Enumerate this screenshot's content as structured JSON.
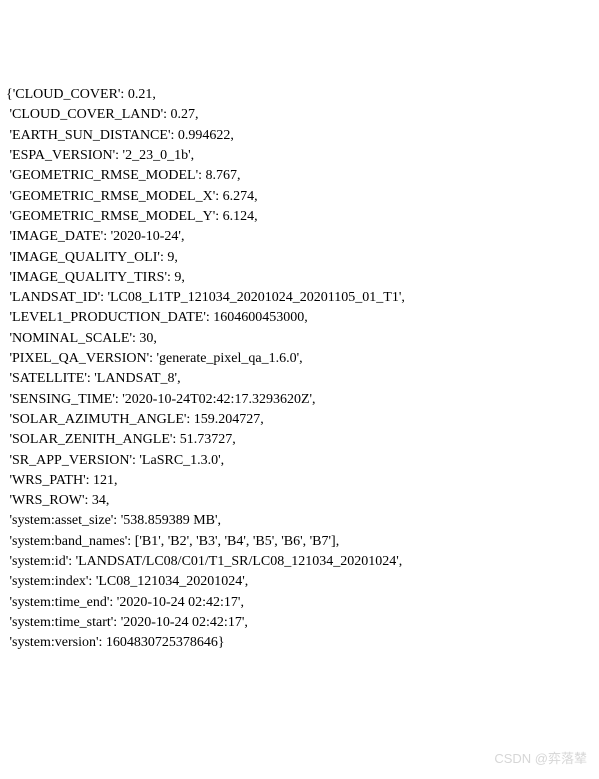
{
  "entries": [
    {
      "key": "CLOUD_COVER",
      "val": "0.21",
      "q": false
    },
    {
      "key": "CLOUD_COVER_LAND",
      "val": "0.27",
      "q": false
    },
    {
      "key": "EARTH_SUN_DISTANCE",
      "val": "0.994622",
      "q": false
    },
    {
      "key": "ESPA_VERSION",
      "val": "2_23_0_1b",
      "q": true
    },
    {
      "key": "GEOMETRIC_RMSE_MODEL",
      "val": "8.767",
      "q": false
    },
    {
      "key": "GEOMETRIC_RMSE_MODEL_X",
      "val": "6.274",
      "q": false
    },
    {
      "key": "GEOMETRIC_RMSE_MODEL_Y",
      "val": "6.124",
      "q": false
    },
    {
      "key": "IMAGE_DATE",
      "val": "2020-10-24",
      "q": true
    },
    {
      "key": "IMAGE_QUALITY_OLI",
      "val": "9",
      "q": false
    },
    {
      "key": "IMAGE_QUALITY_TIRS",
      "val": "9",
      "q": false
    },
    {
      "key": "LANDSAT_ID",
      "val": "LC08_L1TP_121034_20201024_20201105_01_T1",
      "q": true
    },
    {
      "key": "LEVEL1_PRODUCTION_DATE",
      "val": "1604600453000",
      "q": false
    },
    {
      "key": "NOMINAL_SCALE",
      "val": "30",
      "q": false
    },
    {
      "key": "PIXEL_QA_VERSION",
      "val": "generate_pixel_qa_1.6.0",
      "q": true
    },
    {
      "key": "SATELLITE",
      "val": "LANDSAT_8",
      "q": true
    },
    {
      "key": "SENSING_TIME",
      "val": "2020-10-24T02:42:17.3293620Z",
      "q": true
    },
    {
      "key": "SOLAR_AZIMUTH_ANGLE",
      "val": "159.204727",
      "q": false
    },
    {
      "key": "SOLAR_ZENITH_ANGLE",
      "val": "51.73727",
      "q": false
    },
    {
      "key": "SR_APP_VERSION",
      "val": "LaSRC_1.3.0",
      "q": true
    },
    {
      "key": "WRS_PATH",
      "val": "121",
      "q": false
    },
    {
      "key": "WRS_ROW",
      "val": "34",
      "q": false
    },
    {
      "key": "system:asset_size",
      "val": "538.859389 MB",
      "q": true
    },
    {
      "key": "system:band_names",
      "raw": "['B1', 'B2', 'B3', 'B4', 'B5', 'B6', 'B7']"
    },
    {
      "key": "system:id",
      "val": "LANDSAT/LC08/C01/T1_SR/LC08_121034_20201024",
      "q": true
    },
    {
      "key": "system:index",
      "val": "LC08_121034_20201024",
      "q": true
    },
    {
      "key": "system:time_end",
      "val": "2020-10-24 02:42:17",
      "q": true
    },
    {
      "key": "system:time_start",
      "val": "2020-10-24 02:42:17",
      "q": true
    },
    {
      "key": "system:version",
      "val": "1604830725378646",
      "q": false
    }
  ],
  "watermark": "CSDN @弈落辇"
}
